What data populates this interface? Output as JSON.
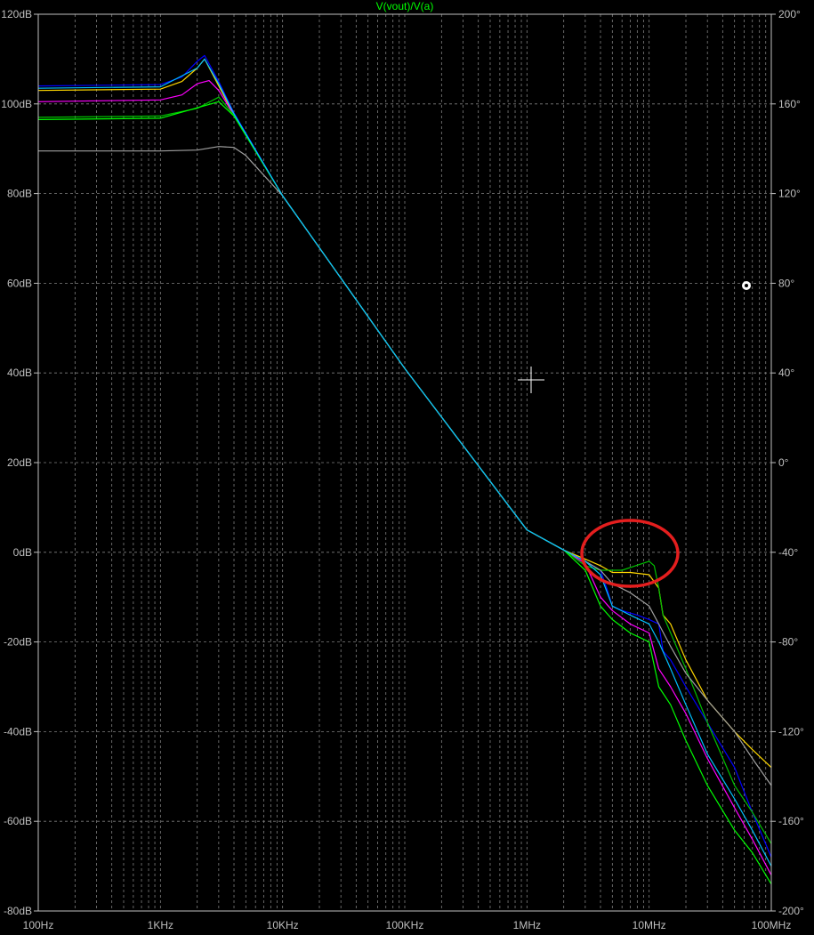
{
  "colors": {
    "background": "#000000",
    "grid": "#7f7f7f",
    "axis": "#bfbfbf",
    "title": "#00ff00",
    "annotation": "#e41e1e",
    "cursor": "#ffffff"
  },
  "chart_data": {
    "type": "line",
    "title": "V(vout)/V(a)",
    "xscale": "log",
    "xlim": [
      100,
      100000000
    ],
    "ylim": [
      -80,
      120
    ],
    "y2lim": [
      -200,
      200
    ],
    "grid": true,
    "x_ticks": [
      {
        "value": 100,
        "label": "100Hz"
      },
      {
        "value": 1000,
        "label": "1KHz"
      },
      {
        "value": 10000,
        "label": "10KHz"
      },
      {
        "value": 100000,
        "label": "100KHz"
      },
      {
        "value": 1000000,
        "label": "1MHz"
      },
      {
        "value": 10000000,
        "label": "10MHz"
      },
      {
        "value": 100000000,
        "label": "100MHz"
      }
    ],
    "y_ticks": [
      {
        "value": 120,
        "label": "120dB"
      },
      {
        "value": 100,
        "label": "100dB"
      },
      {
        "value": 80,
        "label": "80dB"
      },
      {
        "value": 60,
        "label": "60dB"
      },
      {
        "value": 40,
        "label": "40dB"
      },
      {
        "value": 20,
        "label": "20dB"
      },
      {
        "value": 0,
        "label": "0dB"
      },
      {
        "value": -20,
        "label": "-20dB"
      },
      {
        "value": -40,
        "label": "-40dB"
      },
      {
        "value": -60,
        "label": "-60dB"
      },
      {
        "value": -80,
        "label": "-80dB"
      }
    ],
    "y2_ticks": [
      {
        "value": 200,
        "label": "200°"
      },
      {
        "value": 160,
        "label": "160°"
      },
      {
        "value": 120,
        "label": "120°"
      },
      {
        "value": 80,
        "label": "80°"
      },
      {
        "value": 40,
        "label": "40°"
      },
      {
        "value": 0,
        "label": "0°"
      },
      {
        "value": -40,
        "label": "-40°"
      },
      {
        "value": -80,
        "label": "-80°"
      },
      {
        "value": -120,
        "label": "-120°"
      },
      {
        "value": -160,
        "label": "-160°"
      },
      {
        "value": -200,
        "label": "-200°"
      }
    ],
    "series": [
      {
        "color": "#0000ff",
        "values": [
          [
            100,
            104
          ],
          [
            1000,
            104.3
          ],
          [
            1500,
            106
          ],
          [
            2000,
            109.5
          ],
          [
            2300,
            110.8
          ],
          [
            3000,
            105
          ],
          [
            4000,
            98
          ],
          [
            10000,
            79.5
          ],
          [
            100000,
            41
          ],
          [
            1000000,
            5
          ],
          [
            2000000,
            0.5
          ],
          [
            3000000,
            -2
          ],
          [
            4000000,
            -4
          ],
          [
            4500000,
            -8
          ],
          [
            5000000,
            -12
          ],
          [
            6000000,
            -13
          ],
          [
            8000000,
            -14
          ],
          [
            10000000,
            -15
          ],
          [
            12000000,
            -16
          ],
          [
            13000000,
            -22
          ],
          [
            15000000,
            -24
          ],
          [
            20000000,
            -30
          ],
          [
            30000000,
            -38
          ],
          [
            50000000,
            -48
          ],
          [
            70000000,
            -58
          ],
          [
            100000000,
            -68
          ]
        ]
      },
      {
        "color": "#ffd700",
        "values": [
          [
            100,
            103
          ],
          [
            1000,
            103.3
          ],
          [
            1500,
            105
          ],
          [
            2000,
            108
          ],
          [
            2300,
            110
          ],
          [
            3000,
            104
          ],
          [
            4000,
            97.5
          ],
          [
            10000,
            79.5
          ],
          [
            100000,
            41
          ],
          [
            1000000,
            5
          ],
          [
            2000000,
            0.5
          ],
          [
            3000000,
            -1.5
          ],
          [
            4000000,
            -3
          ],
          [
            5000000,
            -4.5
          ],
          [
            7000000,
            -4.5
          ],
          [
            10000000,
            -5
          ],
          [
            12000000,
            -8
          ],
          [
            13000000,
            -14
          ],
          [
            15000000,
            -16
          ],
          [
            20000000,
            -24
          ],
          [
            30000000,
            -33
          ],
          [
            50000000,
            -40
          ],
          [
            70000000,
            -44
          ],
          [
            100000000,
            -48
          ]
        ]
      },
      {
        "color": "#ff00ff",
        "values": [
          [
            100,
            100.5
          ],
          [
            1000,
            100.9
          ],
          [
            1500,
            102
          ],
          [
            2000,
            104.5
          ],
          [
            2500,
            105.2
          ],
          [
            3000,
            103
          ],
          [
            4000,
            97.5
          ],
          [
            10000,
            79.5
          ],
          [
            100000,
            41
          ],
          [
            1000000,
            5
          ],
          [
            2000000,
            0.5
          ],
          [
            3000000,
            -2.5
          ],
          [
            4000000,
            -10
          ],
          [
            5000000,
            -13
          ],
          [
            7000000,
            -16
          ],
          [
            10000000,
            -18
          ],
          [
            12000000,
            -26
          ],
          [
            15000000,
            -30
          ],
          [
            20000000,
            -36
          ],
          [
            30000000,
            -46
          ],
          [
            50000000,
            -57
          ],
          [
            70000000,
            -64
          ],
          [
            100000000,
            -72
          ]
        ]
      },
      {
        "color": "#00c000",
        "values": [
          [
            100,
            97
          ],
          [
            1000,
            97.3
          ],
          [
            2000,
            99
          ],
          [
            3000,
            101.5
          ],
          [
            4000,
            97.5
          ],
          [
            10000,
            79.5
          ],
          [
            100000,
            41
          ],
          [
            1000000,
            5
          ],
          [
            2000000,
            0.5
          ],
          [
            3000000,
            -3
          ],
          [
            4000000,
            -4
          ],
          [
            6000000,
            -4
          ],
          [
            10000000,
            -2
          ],
          [
            11000000,
            -3
          ],
          [
            12000000,
            -8
          ],
          [
            13000000,
            -14
          ],
          [
            20000000,
            -26
          ],
          [
            30000000,
            -38
          ],
          [
            50000000,
            -52
          ],
          [
            70000000,
            -58
          ],
          [
            100000000,
            -65
          ]
        ]
      },
      {
        "color": "#00ff00",
        "values": [
          [
            100,
            96.5
          ],
          [
            1000,
            96.8
          ],
          [
            3000,
            100.5
          ],
          [
            4000,
            97.3
          ],
          [
            10000,
            79.5
          ],
          [
            100000,
            41
          ],
          [
            1000000,
            5
          ],
          [
            2000000,
            0.5
          ],
          [
            3000000,
            -4
          ],
          [
            4000000,
            -12
          ],
          [
            5000000,
            -15
          ],
          [
            7000000,
            -18
          ],
          [
            10000000,
            -20
          ],
          [
            12000000,
            -30
          ],
          [
            15000000,
            -34
          ],
          [
            20000000,
            -42
          ],
          [
            30000000,
            -52
          ],
          [
            50000000,
            -62
          ],
          [
            70000000,
            -67
          ],
          [
            100000000,
            -74
          ]
        ]
      },
      {
        "color": "#a0a0a0",
        "values": [
          [
            100,
            89.5
          ],
          [
            1000,
            89.5
          ],
          [
            2000,
            89.7
          ],
          [
            3000,
            90.5
          ],
          [
            4000,
            90.3
          ],
          [
            5000,
            88.5
          ],
          [
            10000,
            79.5
          ],
          [
            100000,
            41
          ],
          [
            1000000,
            5
          ],
          [
            2000000,
            0.5
          ],
          [
            3000000,
            -2
          ],
          [
            4000000,
            -4
          ],
          [
            5000000,
            -7
          ],
          [
            7000000,
            -9
          ],
          [
            10000000,
            -12
          ],
          [
            12000000,
            -16
          ],
          [
            15000000,
            -21
          ],
          [
            20000000,
            -27
          ],
          [
            30000000,
            -33
          ],
          [
            50000000,
            -40
          ],
          [
            70000000,
            -46
          ],
          [
            100000000,
            -52
          ]
        ]
      },
      {
        "color": "#00bfff",
        "values": [
          [
            100,
            103.5
          ],
          [
            1000,
            103.8
          ],
          [
            2000,
            108
          ],
          [
            2300,
            110
          ],
          [
            3000,
            104.5
          ],
          [
            4000,
            97.8
          ],
          [
            10000,
            79.5
          ],
          [
            100000,
            41
          ],
          [
            1000000,
            5
          ],
          [
            2000000,
            0.5
          ],
          [
            3000000,
            -2
          ],
          [
            4000000,
            -5
          ],
          [
            5000000,
            -12
          ],
          [
            7000000,
            -14
          ],
          [
            10000000,
            -16
          ],
          [
            12000000,
            -20
          ],
          [
            15000000,
            -26
          ],
          [
            20000000,
            -34
          ],
          [
            30000000,
            -45
          ],
          [
            50000000,
            -55
          ],
          [
            70000000,
            -62
          ],
          [
            100000000,
            -70
          ]
        ]
      }
    ]
  }
}
